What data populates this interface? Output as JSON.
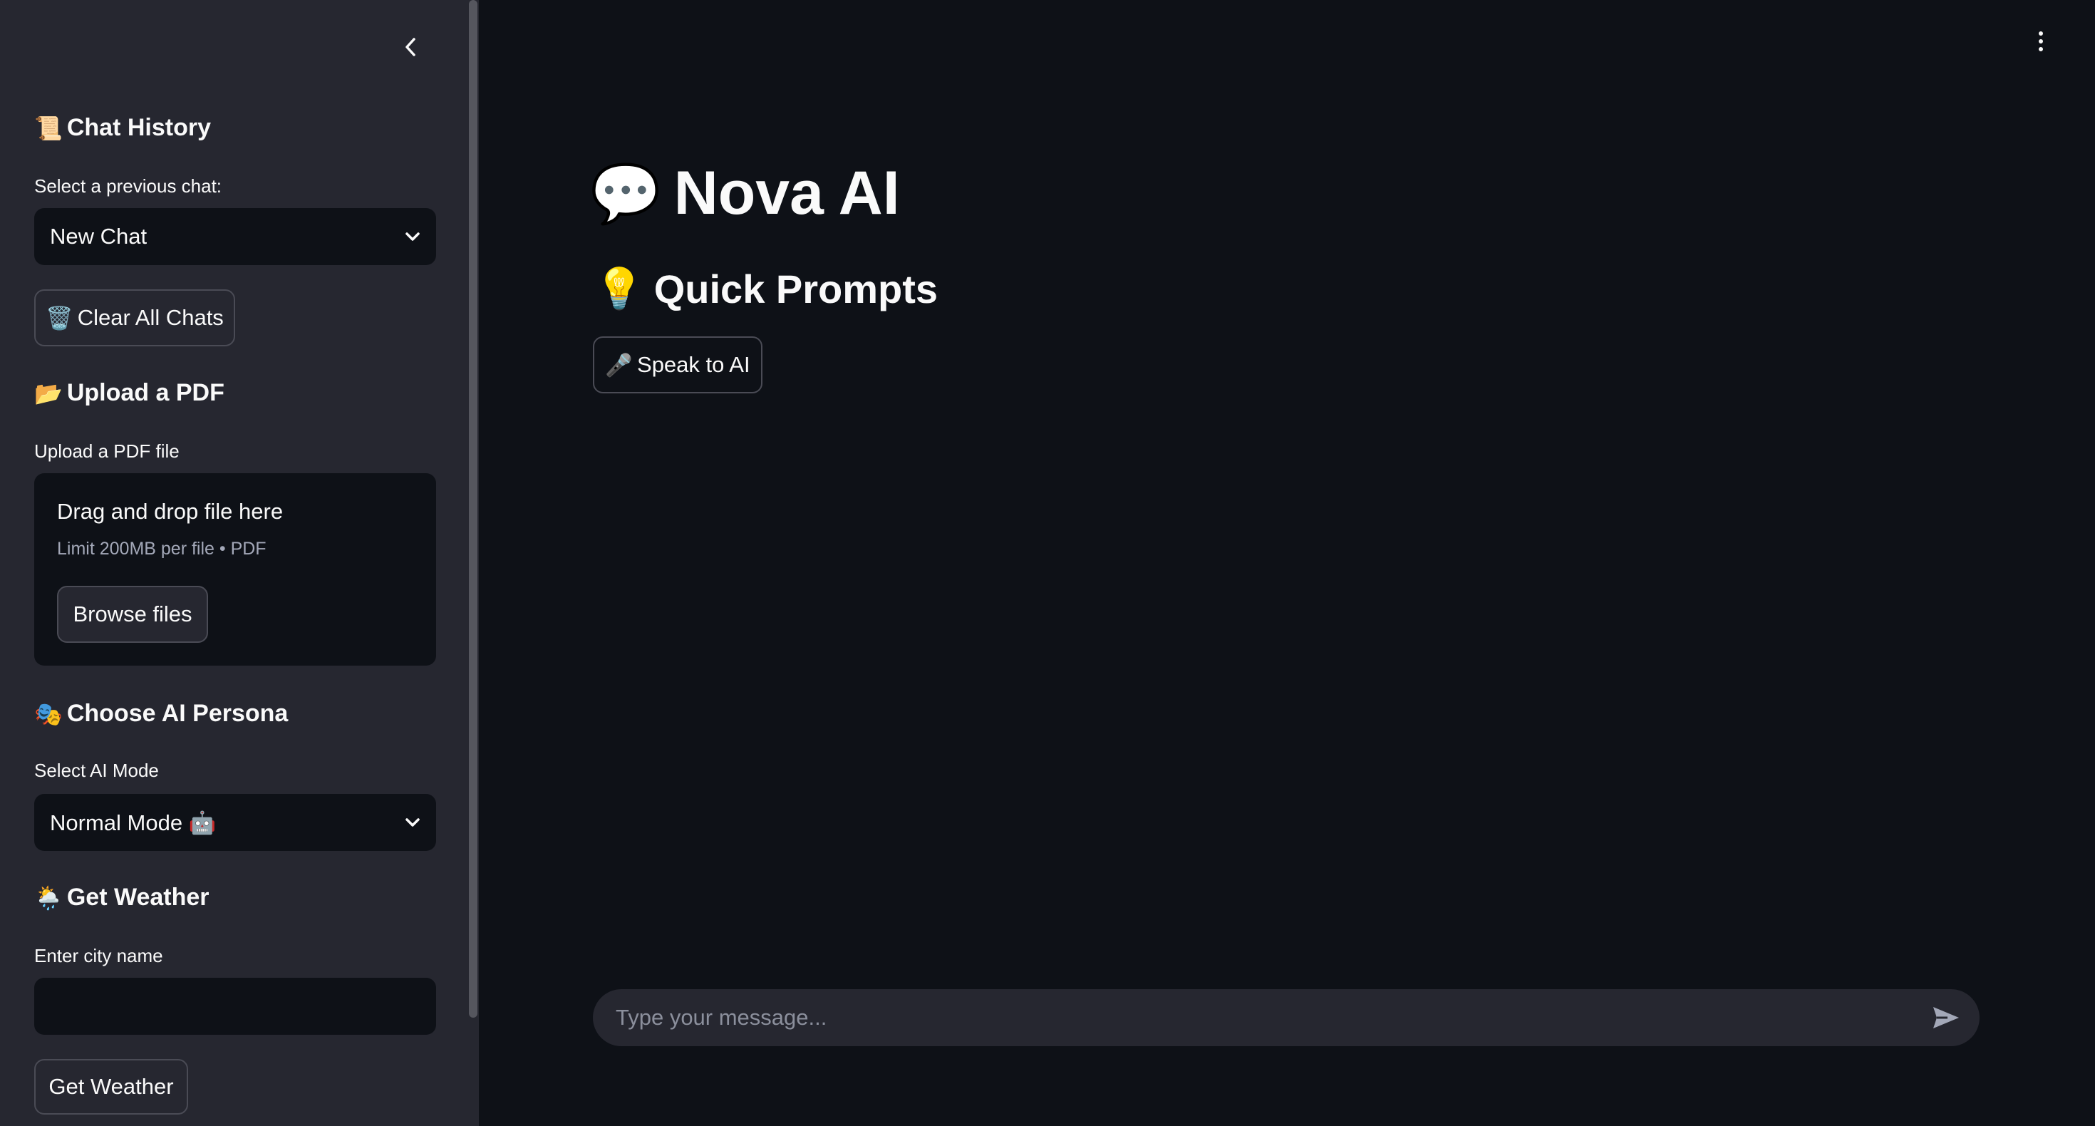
{
  "sidebar": {
    "chat_history": {
      "icon": "📜",
      "heading": "Chat History",
      "select_label": "Select a previous chat:",
      "selected": "New Chat"
    },
    "clear_button": {
      "icon": "🗑️",
      "label": "Clear All Chats"
    },
    "upload": {
      "icon": "📂",
      "heading": "Upload a PDF",
      "label": "Upload a PDF file",
      "drop_title": "Drag and drop file here",
      "drop_limit": "Limit 200MB per file • PDF",
      "browse_label": "Browse files"
    },
    "persona": {
      "icon": "🎭",
      "heading": "Choose AI Persona",
      "select_label": "Select AI Mode",
      "selected": "Normal Mode 🤖"
    },
    "weather": {
      "icon": "🌦️",
      "heading": "Get Weather",
      "input_label": "Enter city name",
      "input_value": "",
      "button_label": "Get Weather"
    }
  },
  "main": {
    "title_icon": "💬",
    "title": "Nova AI",
    "quick_prompts": {
      "icon": "💡",
      "heading": "Quick Prompts"
    },
    "speak_button": {
      "icon": "🎤",
      "label": "Speak to AI"
    },
    "chat_input": {
      "placeholder": "Type your message...",
      "value": ""
    }
  },
  "icons": {
    "collapse": "chevron-left-icon",
    "menu": "kebab-menu-icon",
    "dropdown": "chevron-down-icon",
    "send": "send-icon"
  },
  "colors": {
    "background": "#0e1117",
    "sidebar": "#262730",
    "text": "#fafafa",
    "muted_text": "#a3a8b8",
    "border": "#4a4b55"
  }
}
